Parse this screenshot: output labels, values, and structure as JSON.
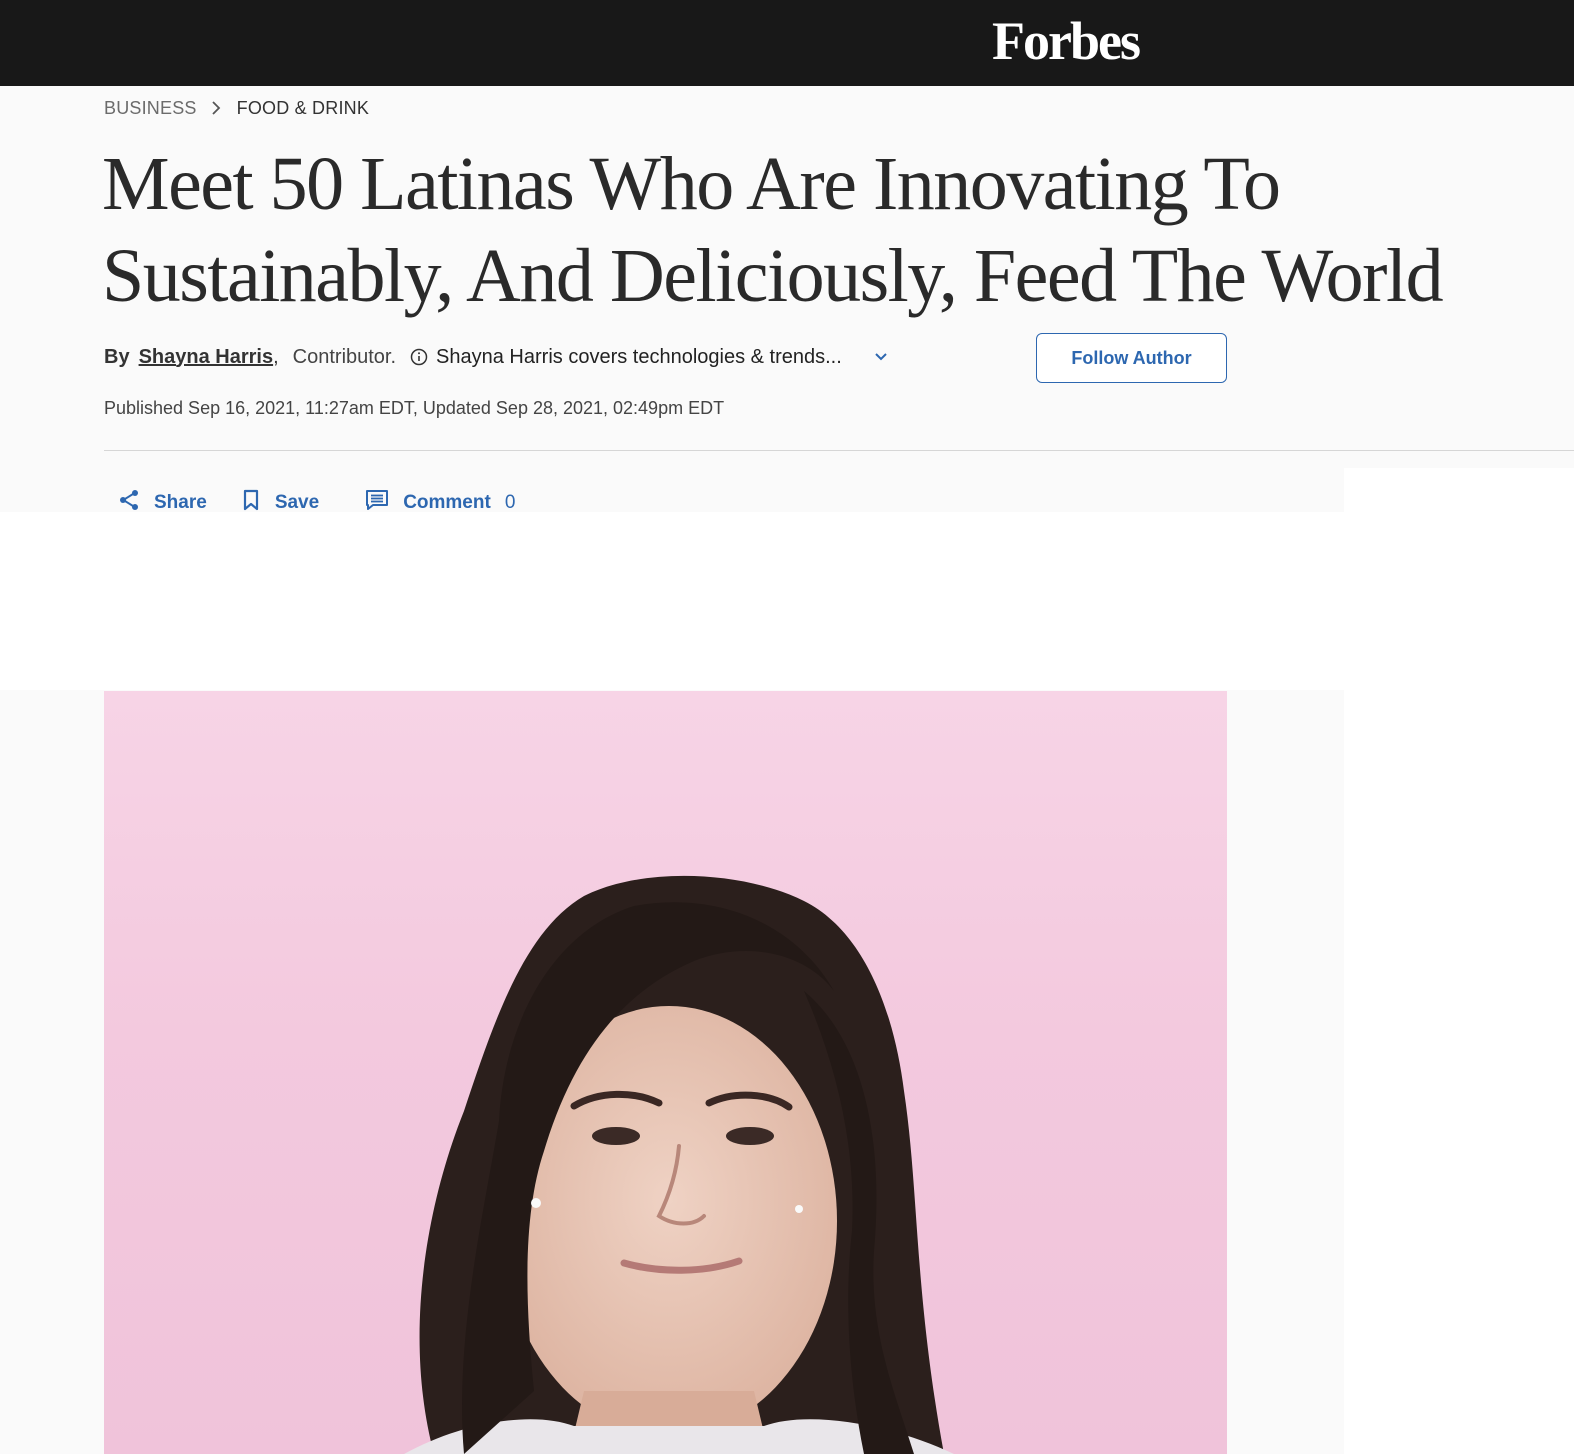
{
  "header": {
    "logo": "Forbes"
  },
  "breadcrumb": {
    "section": "BUSINESS",
    "subsection": "FOOD & DRINK"
  },
  "article": {
    "headline_line1": "Meet 50 Latinas Who Are Innovating To",
    "headline_line2": "Sustainably, And Deliciously, Feed The World",
    "by_label": "By",
    "author": "Shayna Harris",
    "role": "Contributor.",
    "author_desc": "Shayna Harris covers technologies & trends...",
    "follow_label": "Follow Author",
    "dates": "Published Sep 16, 2021, 11:27am EDT, Updated Sep 28, 2021, 02:49pm EDT"
  },
  "actions": {
    "share_label": "Share",
    "save_label": "Save",
    "comment_label": "Comment",
    "comment_count": "0"
  },
  "icons": {
    "breadcrumb_sep": "chevron-right-icon",
    "info": "info-icon",
    "expand": "chevron-down-icon",
    "share": "share-icon",
    "save": "bookmark-icon",
    "comment": "comment-icon"
  },
  "colors": {
    "topbar": "#181818",
    "accent": "#2d67b0",
    "page_bg": "#fafafa",
    "photo_bg": "#f2c6dc"
  }
}
